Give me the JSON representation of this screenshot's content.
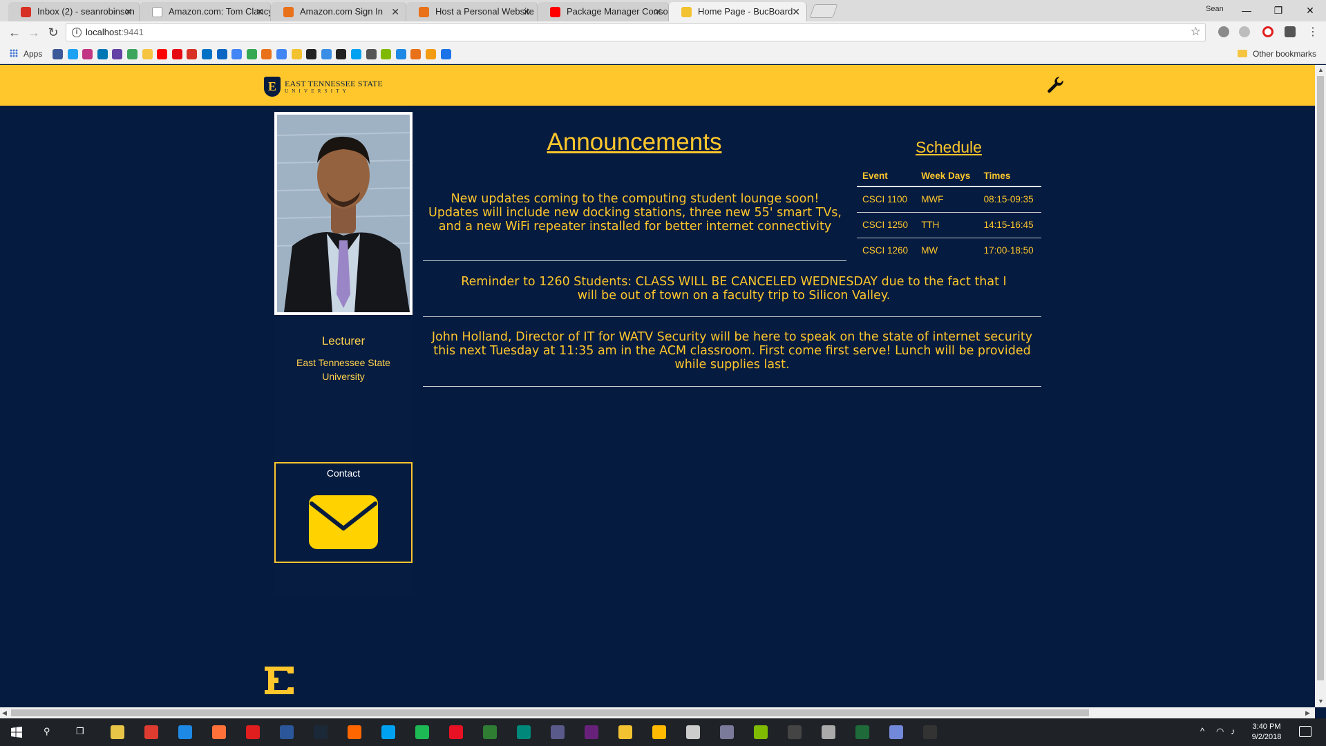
{
  "browser": {
    "tabs": [
      {
        "title": "Inbox (2) - seanrobinson",
        "color": "#d93025"
      },
      {
        "title": "Amazon.com: Tom Clancy",
        "color": "#222222"
      },
      {
        "title": "Amazon.com Sign In",
        "color": "#e8711a"
      },
      {
        "title": "Host a Personal Website",
        "color": "#e8711a"
      },
      {
        "title": "Package Manager Conso",
        "color": "#ff0000"
      },
      {
        "title": "Home Page - BucBoard",
        "color": "#f2c230"
      }
    ],
    "user_label": "Sean",
    "window_controls": {
      "minimize": "—",
      "maximize": "❐",
      "close": "✕"
    },
    "url_host": "localhost",
    "url_port": ":9441",
    "bookmarks": {
      "apps_label": "Apps",
      "other_label": "Other bookmarks",
      "icon_colors": [
        "#3b5998",
        "#1da1f2",
        "#c13584",
        "#0077b5",
        "#6441a5",
        "#3ba55c",
        "#f5c542",
        "#ff0000",
        "#e50914",
        "#d93025",
        "#0072c6",
        "#0a66c2",
        "#4285f4",
        "#34a853",
        "#e8711a",
        "#4285f4",
        "#f2c230",
        "#222222",
        "#3a8ee6",
        "#222222",
        "#00a1f1",
        "#555555",
        "#7fba00",
        "#1e88e5",
        "#e8711a",
        "#f39c12",
        "#1a73e8"
      ]
    }
  },
  "site": {
    "logo_line1": "EAST TENNESSEE STATE",
    "logo_line2": "UNIVERSITY",
    "logo_letter": "E",
    "colors": {
      "gold": "#ffc72c",
      "navy": "#051b3f"
    }
  },
  "profile": {
    "role": "Lecturer",
    "affiliation": "East Tennessee State University",
    "contact_label": "Contact"
  },
  "announcements": {
    "title": "Announcements",
    "items": [
      "New updates coming to the computing student lounge soon! Updates will include new docking stations, three new 55' smart TVs, and a new WiFi repeater installed for better internet connectivity",
      "Reminder to 1260 Students: CLASS WILL BE CANCELED WEDNESDAY due to the fact that I will be out of town on a faculty trip to Silicon Valley.",
      "John Holland, Director of IT for WATV Security will be here to speak on the state of internet security this next Tuesday at 11:35 am in the ACM classroom. First come first serve! Lunch will be provided while supplies last."
    ]
  },
  "schedule": {
    "title": "Schedule",
    "headers": [
      "Event",
      "Week Days",
      "Times"
    ],
    "rows": [
      [
        "CSCI 1100",
        "MWF",
        "08:15-09:35"
      ],
      [
        "CSCI 1250",
        "TTH",
        "14:15-16:45"
      ],
      [
        "CSCI 1260",
        "MW",
        "17:00-18:50"
      ]
    ]
  },
  "taskbar": {
    "time": "3:40 PM",
    "date": "9/2/2018",
    "icon_colors": [
      "#e8c547",
      "#de3b30",
      "#1e88e5",
      "#ff7139",
      "#e01e1e",
      "#2b579a",
      "#1b2838",
      "#ff6600",
      "#00a1f1",
      "#1db954",
      "#e81123",
      "#2e7d32",
      "#00897b",
      "#5a5a8a",
      "#68217a",
      "#f2c230",
      "#ffb900",
      "#cccccc",
      "#7a7a9a",
      "#7fba00",
      "#444444",
      "#aaaaaa",
      "#1e6b39",
      "#7289da",
      "#333333"
    ]
  }
}
